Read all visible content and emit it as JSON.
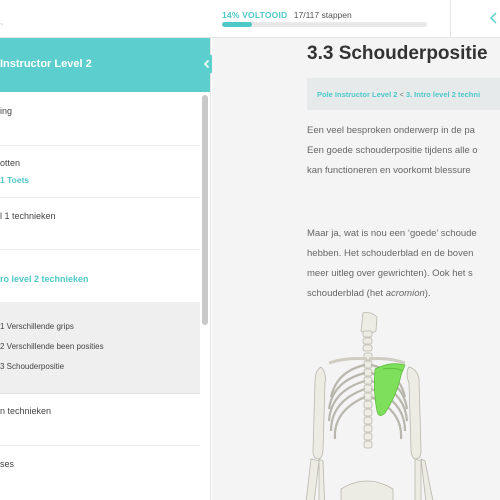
{
  "header": {
    "logo_tail": "~",
    "progress_percent_label": "14% VOLTOOID",
    "progress_steps_label": "17/117 stappen",
    "progress_fraction": 0.145,
    "nav_icon": "chevron-left-icon"
  },
  "sidebar": {
    "title": "Instructor Level 2",
    "collapse_icon": "chevron-left-icon",
    "items": [
      {
        "label": "ing",
        "sub": ""
      },
      {
        "label": "otten",
        "sub": "1 Toets"
      },
      {
        "label": "l 1 technieken",
        "sub": ""
      },
      {
        "label": "ro level 2 technieken",
        "sub": ""
      },
      {
        "label": "n technieken",
        "sub": ""
      },
      {
        "label": "ses",
        "sub": ""
      }
    ],
    "subitems": [
      "1 Verschillende grips",
      "2 Verschillende been posities",
      "3 Schouderpositie"
    ]
  },
  "main": {
    "title": "3.3 Schouderpositie",
    "breadcrumb": {
      "first": "Pole Instructor Level 2",
      "separator": "<",
      "second": "3. Intro level 2 techni"
    },
    "paragraph1": [
      "Een veel besproken onderwerp in de pa",
      "Een goede schouderpositie tijdens alle o",
      "kan functioneren en voorkomt blessure"
    ],
    "paragraph2": [
      "Maar ja, wat is nou een ‘goede’ schoude",
      "hebben. Het schouderblad en de boven",
      "meer uitleg over gewrichten). Ook het s"
    ],
    "paragraph2_last_prefix": "schouderblad (het ",
    "paragraph2_last_italic": "acromion",
    "paragraph2_last_suffix": ")."
  },
  "colors": {
    "accent": "#5dcece",
    "accent_text": "#4fc8c8",
    "scapula_highlight": "#7ee05a"
  }
}
